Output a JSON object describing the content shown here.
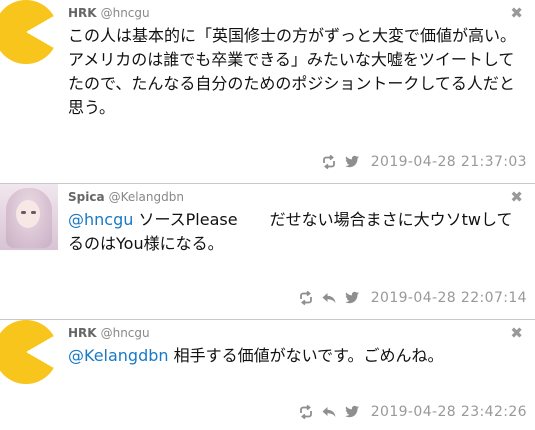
{
  "tweets": [
    {
      "name": "HRK",
      "handle": "@hncgu",
      "avatar": "pacman-avatar",
      "mention": "",
      "text": "この人は基本的に「英国修士の方がずっと大変で価値が高い。アメリカのは誰でも卒業できる」みたいな大嘘をツイートしてたので、たんなる自分のためのポジショントークしてる人だと思う。",
      "timestamp": "2019-04-28 21:37:03",
      "actions": [
        "retweet-icon",
        "twitter-bird-icon"
      ]
    },
    {
      "name": "Spica",
      "handle": "@Kelangdbn",
      "avatar": "photo-avatar",
      "mention": "@hncgu",
      "text": " ソースPlease　　だせない場合まさに大ウソtwしてるのはYou様になる。",
      "timestamp": "2019-04-28 22:07:14",
      "actions": [
        "retweet-icon",
        "reply-icon",
        "twitter-bird-icon"
      ]
    },
    {
      "name": "HRK",
      "handle": "@hncgu",
      "avatar": "pacman-avatar",
      "mention": "@Kelangdbn",
      "text": " 相手する価値がないです。ごめんね。",
      "timestamp": "2019-04-28 23:42:26",
      "actions": [
        "retweet-icon",
        "reply-icon",
        "twitter-bird-icon"
      ]
    }
  ],
  "close_glyph": "✖",
  "colors": {
    "mention": "#1a79c4",
    "pacman": "#f7c51c",
    "meta": "#999999"
  }
}
